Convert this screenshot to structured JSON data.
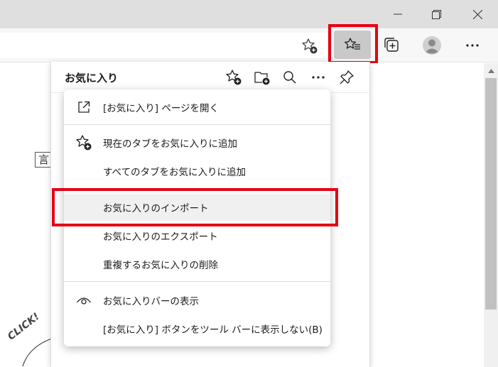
{
  "panel": {
    "title": "お気に入り"
  },
  "menu": {
    "items": [
      {
        "label": "[お気に入り] ページを開く",
        "icon": "open-external-icon"
      },
      {
        "label": "現在のタブをお気に入りに追加",
        "icon": "star-add-icon"
      },
      {
        "label": "すべてのタブをお気に入りに追加"
      },
      {
        "label": "お気に入りのインポート"
      },
      {
        "label": "お気に入りのエクスポート"
      },
      {
        "label": "重複するお気に入りの削除"
      },
      {
        "label": "お気に入りバーの表示",
        "icon": "eye-icon"
      },
      {
        "label": "[お気に入り] ボタンをツール バーに表示しない(B)"
      }
    ]
  },
  "page": {
    "sticky_char": "言",
    "click_text": "CLICK!"
  },
  "colors": {
    "highlight": "#e60012",
    "titlebar": "#dfdfdf",
    "toolbar": "#f7f7f7",
    "menu_hover": "#f0f0f0"
  }
}
